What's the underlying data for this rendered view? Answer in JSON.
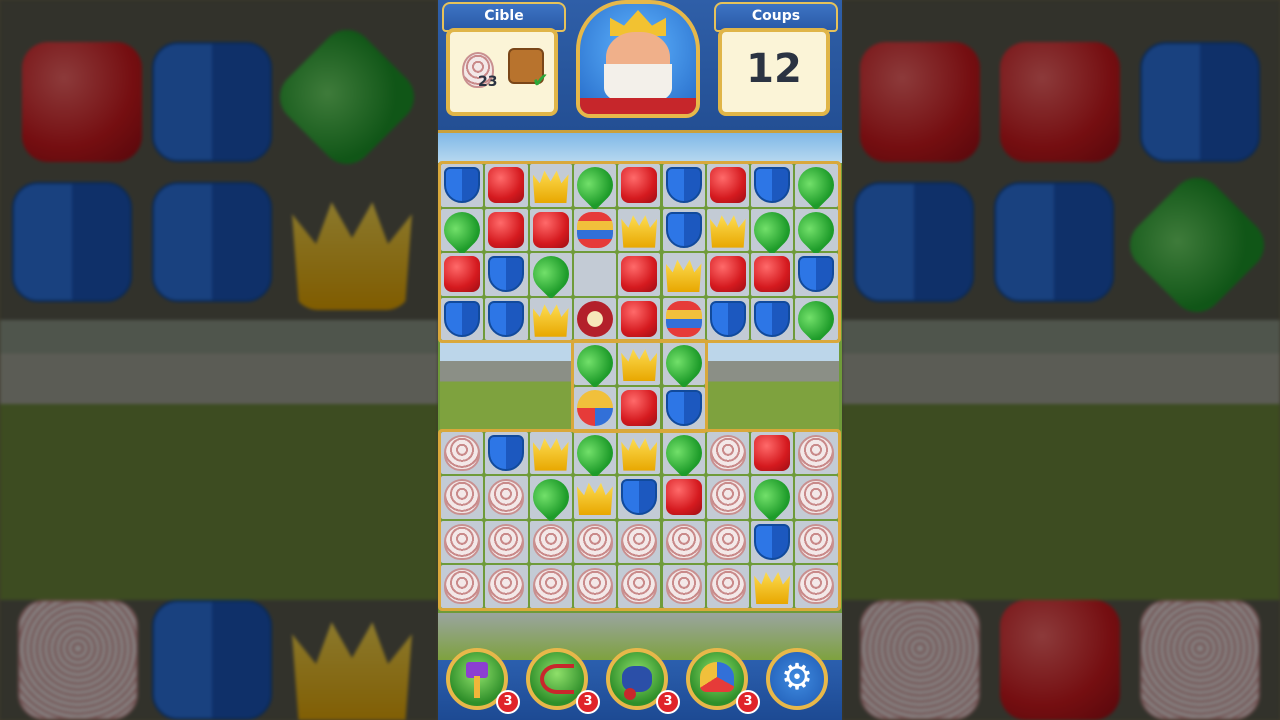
{
  "hud": {
    "target_label": "Cible",
    "target_count": "23",
    "moves_label": "Coups",
    "moves_value": "12"
  },
  "board": {
    "rows": [
      [
        "blue",
        "red",
        "crown",
        "leaf",
        "red",
        "blue",
        "red",
        "blue",
        "leaf"
      ],
      [
        "leaf",
        "red",
        "red",
        "rocket",
        "crown",
        "blue",
        "crown",
        "leaf",
        "leaf"
      ],
      [
        "red",
        "blue",
        "leaf",
        "empty",
        "red",
        "crown",
        "red",
        "red",
        "blue"
      ],
      [
        "blue",
        "blue",
        "crown",
        "tnt",
        "red",
        "rocket",
        "blue",
        "blue",
        "leaf"
      ],
      [
        "none",
        "none",
        "none",
        "leaf",
        "crown",
        "leaf",
        "none",
        "none",
        "none"
      ],
      [
        "none",
        "none",
        "none",
        "jester",
        "red",
        "blue",
        "none",
        "none",
        "none"
      ],
      [
        "egg",
        "blue",
        "crown",
        "leaf",
        "crown",
        "leaf",
        "egg",
        "red",
        "egg"
      ],
      [
        "egg",
        "egg",
        "leaf",
        "crown",
        "blue",
        "red",
        "egg",
        "leaf",
        "egg"
      ],
      [
        "egg",
        "egg",
        "egg",
        "egg",
        "egg",
        "egg",
        "egg",
        "blue",
        "egg"
      ],
      [
        "egg",
        "egg",
        "egg",
        "egg",
        "egg",
        "egg",
        "egg",
        "crown",
        "egg"
      ]
    ]
  },
  "boosters": [
    {
      "name": "hammer",
      "count": "3"
    },
    {
      "name": "arrow",
      "count": "3"
    },
    {
      "name": "cannon",
      "count": "3"
    },
    {
      "name": "jester-hat",
      "count": "3"
    }
  ],
  "colors": {
    "hud_blue": "#2f5fa8",
    "gold_border": "#e0b548",
    "badge_red": "#e0242a"
  }
}
